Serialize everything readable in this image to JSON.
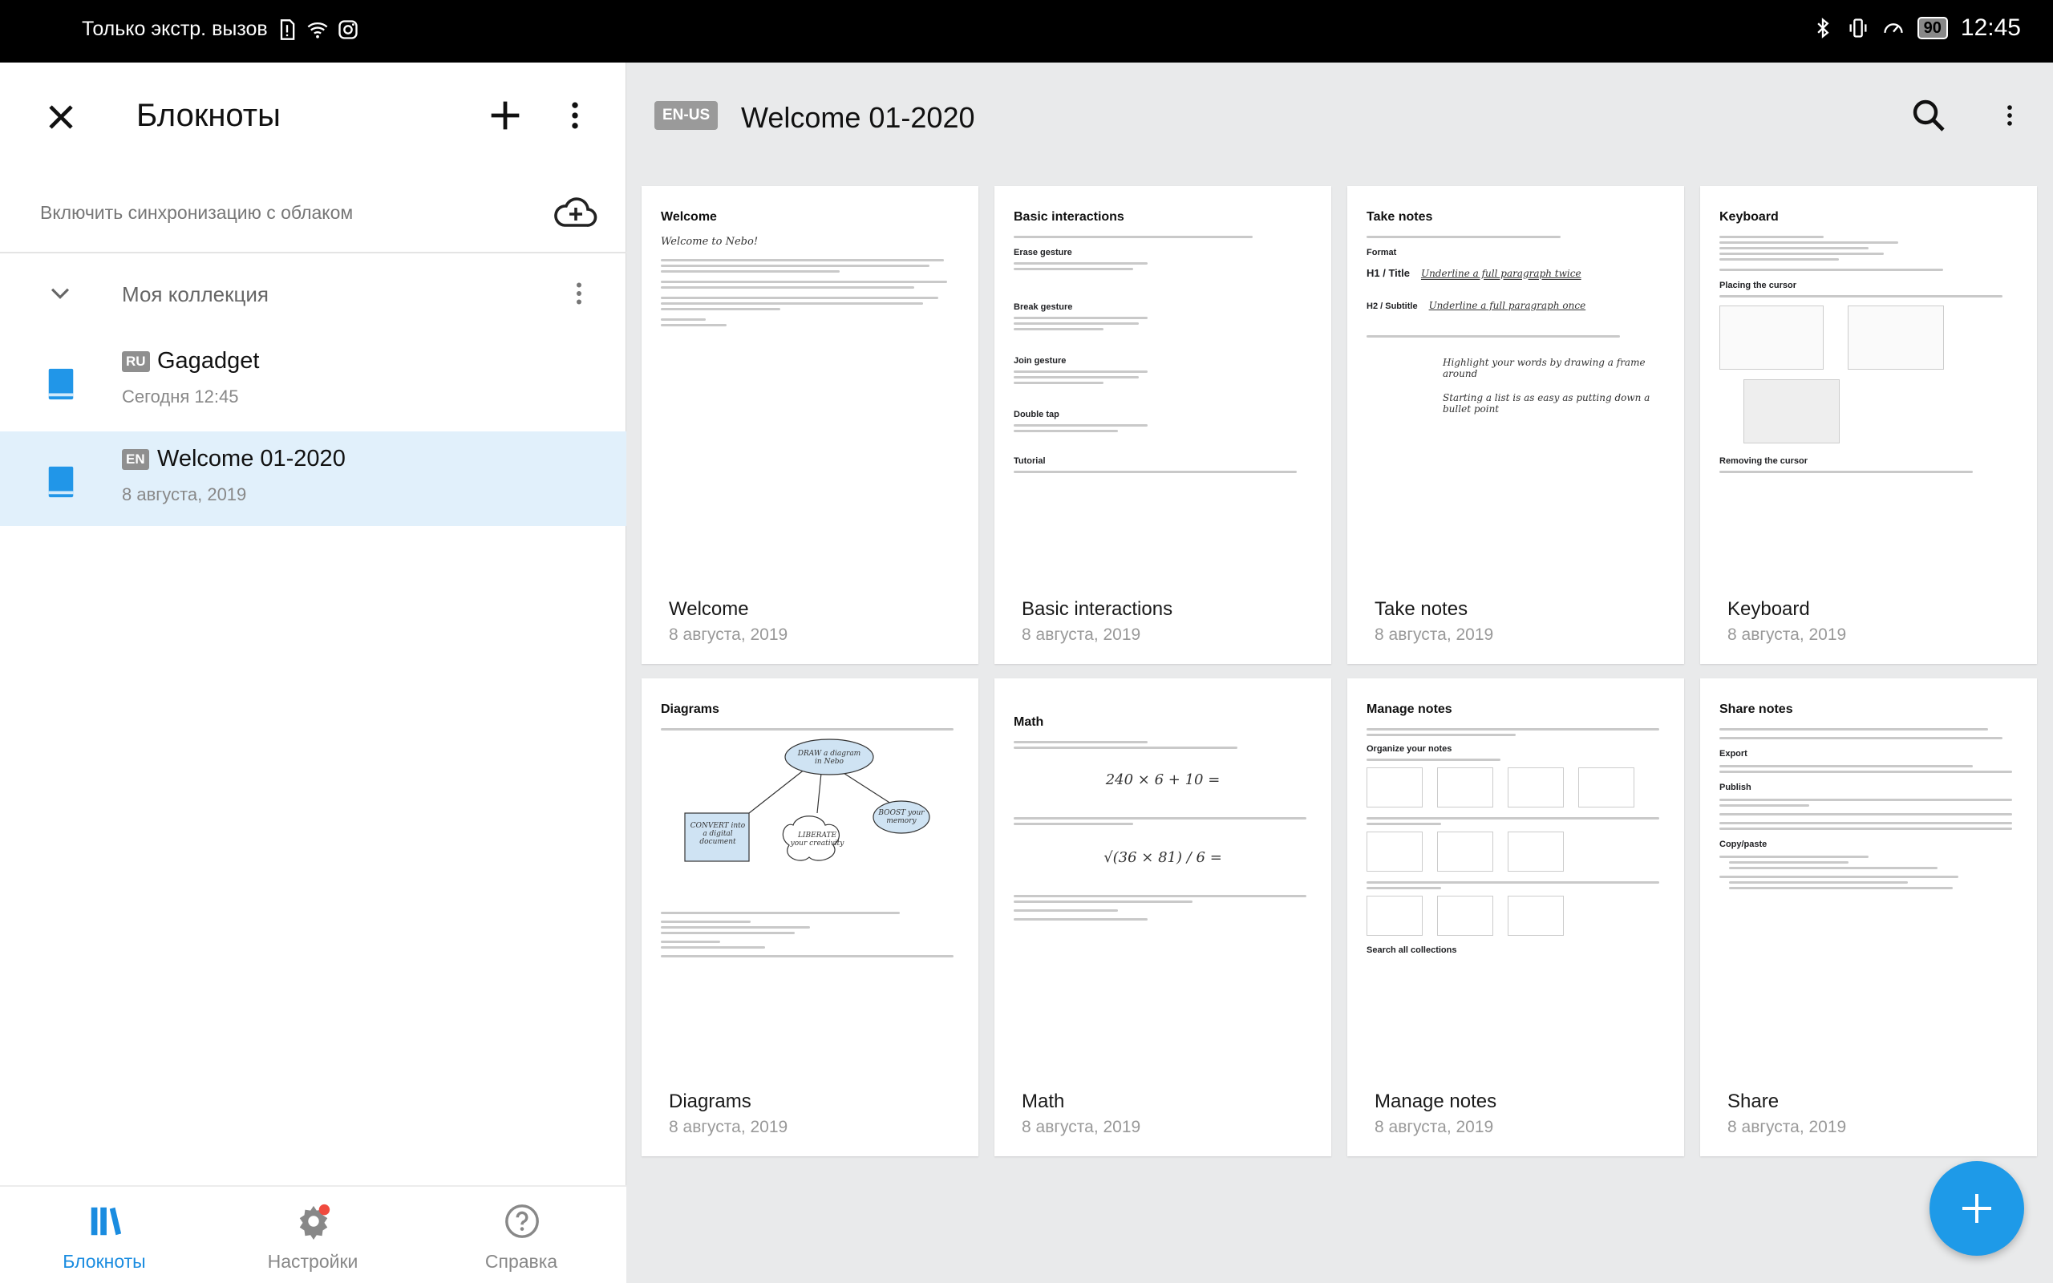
{
  "status_bar": {
    "carrier_text": "Только экстр. вызов",
    "battery": "90",
    "time": "12:45"
  },
  "left_panel": {
    "title": "Блокноты",
    "sync_text": "Включить синхронизацию с облаком",
    "collection_name": "Моя коллекция",
    "notebooks": [
      {
        "lang": "RU",
        "title": "Gagadget",
        "date": "Сегодня 12:45",
        "selected": false
      },
      {
        "lang": "EN",
        "title": "Welcome 01-2020",
        "date": "8 августа, 2019",
        "selected": true
      }
    ]
  },
  "bottom_nav": {
    "notebooks": "Блокноты",
    "settings": "Настройки",
    "help": "Справка"
  },
  "header": {
    "lang": "EN-US",
    "title": "Welcome 01-2020"
  },
  "pages": [
    {
      "name": "Welcome",
      "date": "8 августа, 2019",
      "heading": "Welcome",
      "hand": "Welcome to Nebo!"
    },
    {
      "name": "Basic interactions",
      "date": "8 августа, 2019",
      "heading": "Basic interactions",
      "sections": [
        "Erase gesture",
        "Break gesture",
        "Join gesture",
        "Double tap",
        "Tutorial"
      ]
    },
    {
      "name": "Take notes",
      "date": "8 августа, 2019",
      "heading": "Take notes",
      "rows": [
        "Format",
        "H1 / Title",
        "H2 / Subtitle"
      ],
      "hand1": "Underline a full paragraph twice",
      "hand2": "Underline a full paragraph once",
      "hand3": "Highlight your words by drawing a frame around",
      "hand4": "Starting a list is as easy as putting down a bullet point"
    },
    {
      "name": "Keyboard",
      "date": "8 августа, 2019",
      "heading": "Keyboard",
      "sections": [
        "Placing the cursor",
        "Removing the cursor"
      ]
    },
    {
      "name": "Diagrams",
      "date": "8 августа, 2019",
      "heading": "Diagrams",
      "nodes": [
        "DRAW a diagram in Nebo",
        "CONVERT into a digital document",
        "LIBERATE your creativity",
        "BOOST your memory"
      ]
    },
    {
      "name": "Math",
      "date": "8 августа, 2019",
      "heading": "Math",
      "eq1": "240 × 6 + 10 =",
      "eq2": "√(36 × 81) / 6 ="
    },
    {
      "name": "Manage notes",
      "date": "8 августа, 2019",
      "heading": "Manage notes",
      "sections": [
        "Organize your notes",
        "Search all collections"
      ]
    },
    {
      "name": "Share",
      "date": "8 августа, 2019",
      "heading": "Share notes",
      "sections": [
        "Export",
        "Publish",
        "Copy/paste"
      ]
    }
  ],
  "colors": {
    "accent": "#1e9ae8",
    "selected_row": "#e1f0fb",
    "notebook_icon": "#2196e8"
  }
}
